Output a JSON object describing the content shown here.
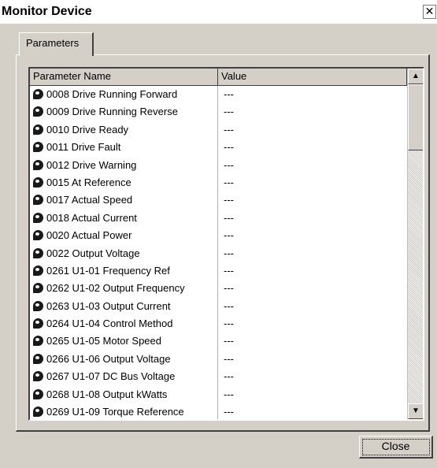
{
  "window": {
    "title": "Monitor Device",
    "close_glyph": "✕"
  },
  "tabs": [
    {
      "label": "Parameters"
    }
  ],
  "table": {
    "columns": [
      "Parameter Name",
      "Value"
    ],
    "rows": [
      {
        "name": "0008 Drive Running Forward",
        "value": "---"
      },
      {
        "name": "0009 Drive Running Reverse",
        "value": "---"
      },
      {
        "name": "0010 Drive Ready",
        "value": "---"
      },
      {
        "name": "0011 Drive Fault",
        "value": "---"
      },
      {
        "name": "0012 Drive Warning",
        "value": "---"
      },
      {
        "name": "0015 At Reference",
        "value": "---"
      },
      {
        "name": "0017 Actual Speed",
        "value": "---"
      },
      {
        "name": "0018 Actual Current",
        "value": "---"
      },
      {
        "name": "0020 Actual Power",
        "value": "---"
      },
      {
        "name": "0022 Output Voltage",
        "value": "---"
      },
      {
        "name": "0261 U1-01 Frequency Ref",
        "value": "---"
      },
      {
        "name": "0262 U1-02 Output Frequency",
        "value": "---"
      },
      {
        "name": "0263 U1-03 Output Current",
        "value": "---"
      },
      {
        "name": "0264 U1-04 Control Method",
        "value": "---"
      },
      {
        "name": "0265 U1-05 Motor Speed",
        "value": "---"
      },
      {
        "name": "0266 U1-06 Output Voltage",
        "value": "---"
      },
      {
        "name": "0267 U1-07 DC Bus Voltage",
        "value": "---"
      },
      {
        "name": "0268 U1-08 Output kWatts",
        "value": "---"
      },
      {
        "name": "0269 U1-09 Torque Reference",
        "value": "---"
      }
    ],
    "row_icon": "pushpin-icon"
  },
  "scrollbar": {
    "up_glyph": "▲",
    "down_glyph": "▼"
  },
  "buttons": {
    "close_label": "Close"
  }
}
